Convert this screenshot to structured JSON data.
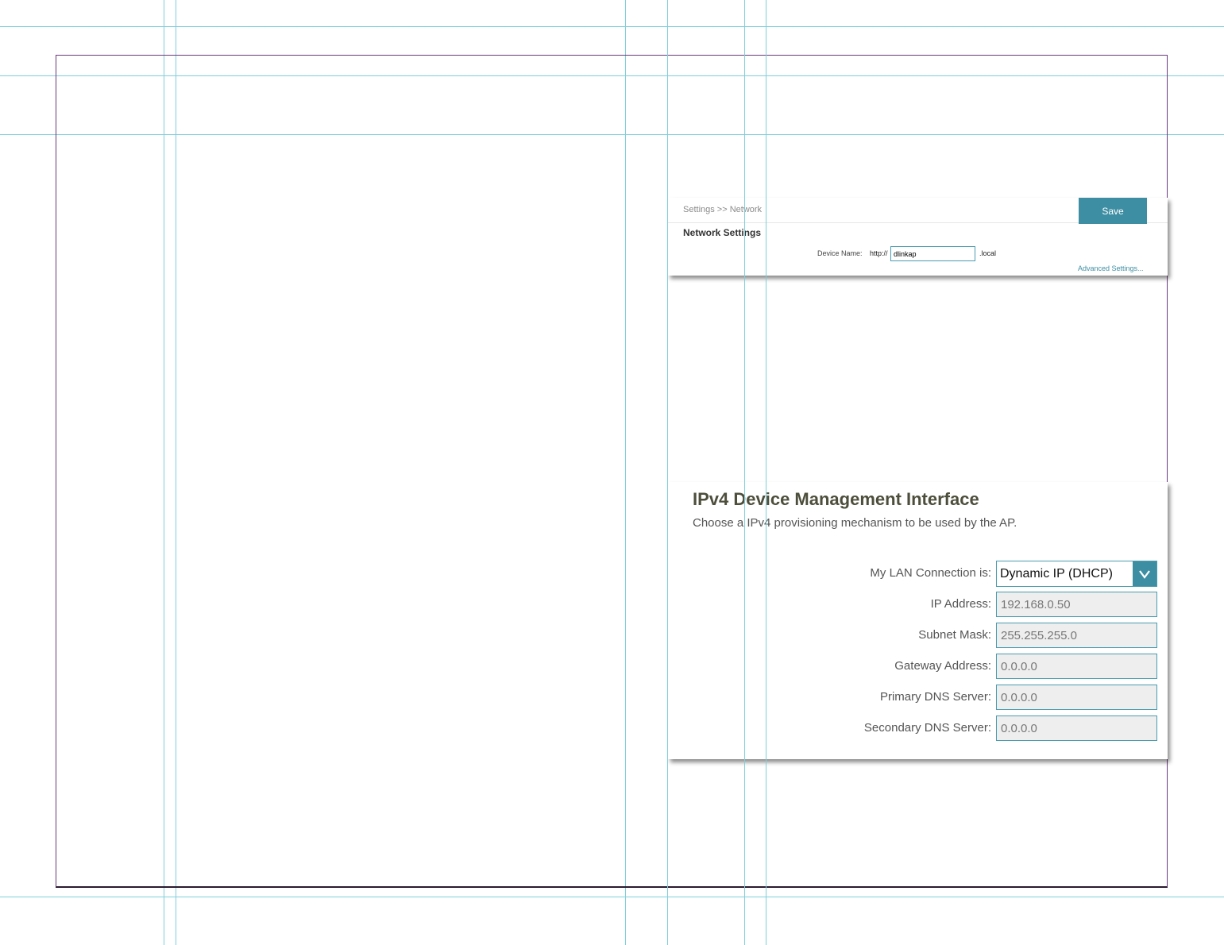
{
  "network_panel": {
    "breadcrumb": "Settings >> Network",
    "save_label": "Save",
    "title": "Network Settings",
    "device_name_label": "Device Name:",
    "device_name_prefix": "http://",
    "device_name_value": "dlinkap",
    "device_name_suffix": ".local",
    "advanced_link": "Advanced Settings..."
  },
  "ipv4_panel": {
    "title": "IPv4 Device Management Interface",
    "subtitle": "Choose a IPv4 provisioning mechanism to be used by the AP.",
    "lan_label": "My LAN Connection is:",
    "lan_value": "Dynamic IP (DHCP)",
    "fields": [
      {
        "label": "IP Address:",
        "value": "192.168.0.50"
      },
      {
        "label": "Subnet Mask:",
        "value": "255.255.255.0"
      },
      {
        "label": "Gateway Address:",
        "value": "0.0.0.0"
      },
      {
        "label": "Primary DNS Server:",
        "value": "0.0.0.0"
      },
      {
        "label": "Secondary DNS Server:",
        "value": "0.0.0.0"
      }
    ]
  },
  "colors": {
    "accent": "#3e8ea3",
    "guide": "#7fcfdc",
    "page_border": "#6a3a7c"
  },
  "icons": {
    "dropdown": "chevron-down-icon"
  }
}
